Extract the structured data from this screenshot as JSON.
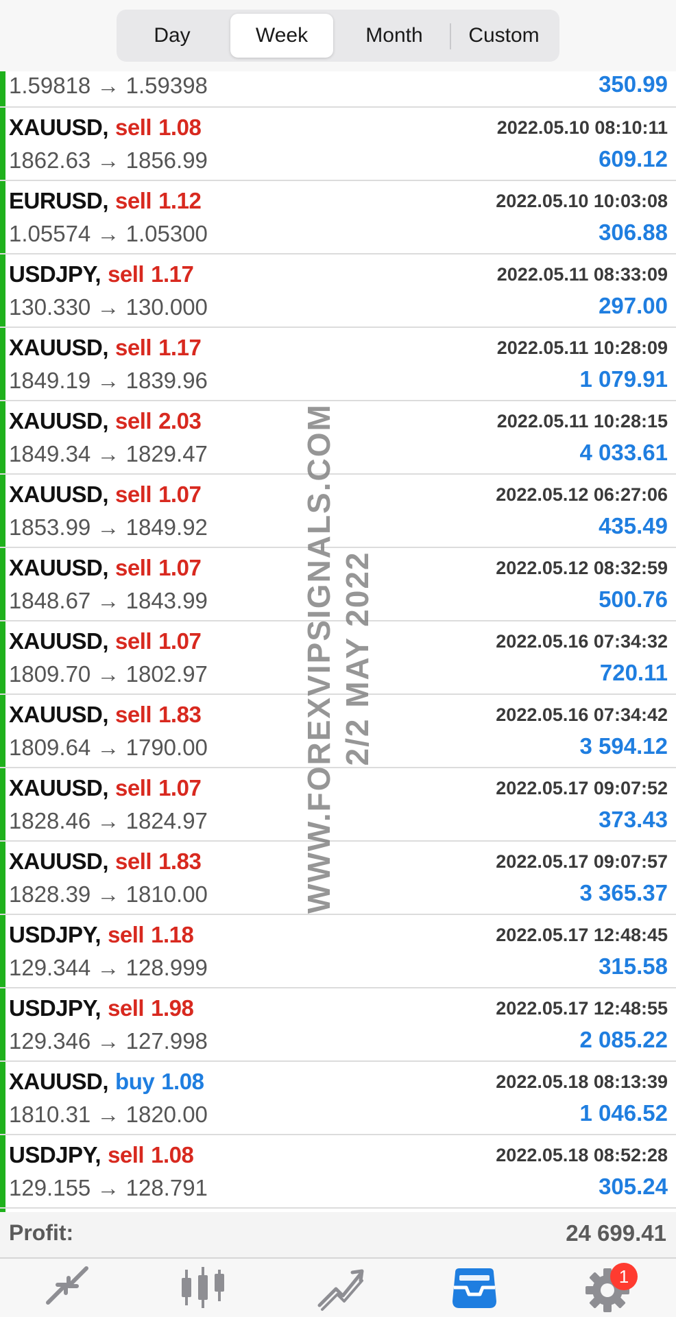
{
  "period_tabs": [
    {
      "label": "Day",
      "active": false
    },
    {
      "label": "Week",
      "active": true
    },
    {
      "label": "Month",
      "active": false
    },
    {
      "label": "Custom",
      "active": false
    }
  ],
  "partial_row": {
    "prices": "1.59818 → 1.59398",
    "profit": "350.99"
  },
  "trades": [
    {
      "symbol": "XAUUSD,",
      "side": "sell",
      "volume": "1.08",
      "time": "2022.05.10 08:10:11",
      "prices": "1862.63 → 1856.99",
      "profit": "609.12"
    },
    {
      "symbol": "EURUSD,",
      "side": "sell",
      "volume": "1.12",
      "time": "2022.05.10 10:03:08",
      "prices": "1.05574 → 1.05300",
      "profit": "306.88"
    },
    {
      "symbol": "USDJPY,",
      "side": "sell",
      "volume": "1.17",
      "time": "2022.05.11 08:33:09",
      "prices": "130.330 → 130.000",
      "profit": "297.00"
    },
    {
      "symbol": "XAUUSD,",
      "side": "sell",
      "volume": "1.17",
      "time": "2022.05.11 10:28:09",
      "prices": "1849.19 → 1839.96",
      "profit": "1 079.91"
    },
    {
      "symbol": "XAUUSD,",
      "side": "sell",
      "volume": "2.03",
      "time": "2022.05.11 10:28:15",
      "prices": "1849.34 → 1829.47",
      "profit": "4 033.61"
    },
    {
      "symbol": "XAUUSD,",
      "side": "sell",
      "volume": "1.07",
      "time": "2022.05.12 06:27:06",
      "prices": "1853.99 → 1849.92",
      "profit": "435.49"
    },
    {
      "symbol": "XAUUSD,",
      "side": "sell",
      "volume": "1.07",
      "time": "2022.05.12 08:32:59",
      "prices": "1848.67 → 1843.99",
      "profit": "500.76"
    },
    {
      "symbol": "XAUUSD,",
      "side": "sell",
      "volume": "1.07",
      "time": "2022.05.16 07:34:32",
      "prices": "1809.70 → 1802.97",
      "profit": "720.11"
    },
    {
      "symbol": "XAUUSD,",
      "side": "sell",
      "volume": "1.83",
      "time": "2022.05.16 07:34:42",
      "prices": "1809.64 → 1790.00",
      "profit": "3 594.12"
    },
    {
      "symbol": "XAUUSD,",
      "side": "sell",
      "volume": "1.07",
      "time": "2022.05.17 09:07:52",
      "prices": "1828.46 → 1824.97",
      "profit": "373.43"
    },
    {
      "symbol": "XAUUSD,",
      "side": "sell",
      "volume": "1.83",
      "time": "2022.05.17 09:07:57",
      "prices": "1828.39 → 1810.00",
      "profit": "3 365.37"
    },
    {
      "symbol": "USDJPY,",
      "side": "sell",
      "volume": "1.18",
      "time": "2022.05.17 12:48:45",
      "prices": "129.344 → 128.999",
      "profit": "315.58"
    },
    {
      "symbol": "USDJPY,",
      "side": "sell",
      "volume": "1.98",
      "time": "2022.05.17 12:48:55",
      "prices": "129.346 → 127.998",
      "profit": "2 085.22"
    },
    {
      "symbol": "XAUUSD,",
      "side": "buy",
      "volume": "1.08",
      "time": "2022.05.18 08:13:39",
      "prices": "1810.31 → 1820.00",
      "profit": "1 046.52"
    },
    {
      "symbol": "USDJPY,",
      "side": "sell",
      "volume": "1.08",
      "time": "2022.05.18 08:52:28",
      "prices": "129.155 → 128.791",
      "profit": "305.24"
    }
  ],
  "summary": {
    "label": "Profit:",
    "value": "24 699.41"
  },
  "watermark": {
    "line1": "WWW.FOREXVIPSIGNALS.COM",
    "line2": "2/2                 MAY 2022"
  },
  "tabbar": {
    "items": [
      {
        "icon": "quotes-icon",
        "active": false
      },
      {
        "icon": "chart-icon",
        "active": false
      },
      {
        "icon": "trade-icon",
        "active": false
      },
      {
        "icon": "history-icon",
        "active": true
      },
      {
        "icon": "settings-icon",
        "active": false
      }
    ],
    "badge": "1"
  },
  "colors": {
    "sell": "#d8291f",
    "buy": "#1f7ee0",
    "profit": "#1f7ee0",
    "accent_green": "#1fb11c",
    "active_tab": "#1f7ee0",
    "inactive_tab": "#8e8e93"
  }
}
